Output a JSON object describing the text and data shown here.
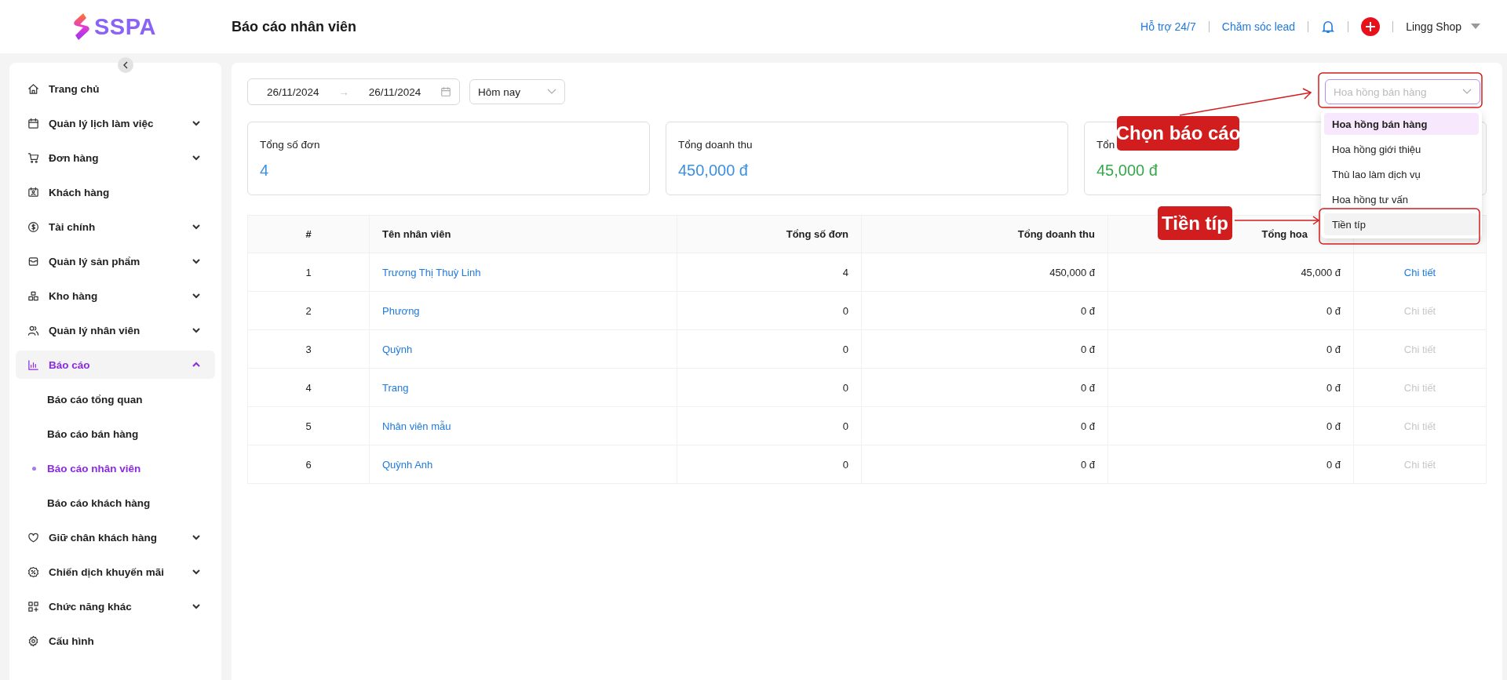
{
  "header": {
    "logo": "SSPA",
    "title": "Báo cáo nhân viên",
    "links": [
      "Hỗ trợ 24/7",
      "Chăm sóc lead"
    ],
    "shop": "Lingg Shop"
  },
  "sidebar": {
    "items": [
      {
        "label": "Trang chủ",
        "selected": false
      },
      {
        "label": "Quản lý lịch làm việc",
        "expanded": false,
        "selected": false
      },
      {
        "label": "Đơn hàng",
        "expanded": false,
        "selected": false
      },
      {
        "label": "Khách hàng",
        "selected": false
      },
      {
        "label": "Tài chính",
        "expanded": false,
        "selected": false
      },
      {
        "label": "Quản lý sản phẩm",
        "expanded": false,
        "selected": false
      },
      {
        "label": "Kho hàng",
        "expanded": false,
        "selected": false
      },
      {
        "label": "Quản lý nhân viên",
        "expanded": false,
        "selected": false
      },
      {
        "label": "Báo cáo",
        "expanded": true,
        "selected": true,
        "children": [
          {
            "label": "Báo cáo tổng quan",
            "selected": false
          },
          {
            "label": "Báo cáo bán hàng",
            "selected": false
          },
          {
            "label": "Báo cáo nhân viên",
            "selected": true
          },
          {
            "label": "Báo cáo khách hàng",
            "selected": false
          }
        ]
      },
      {
        "label": "Giữ chân khách hàng",
        "expanded": false,
        "selected": false
      },
      {
        "label": "Chiến dịch khuyến mãi",
        "expanded": false,
        "selected": false
      },
      {
        "label": "Chức năng khác",
        "expanded": false,
        "selected": false
      },
      {
        "label": "Cấu hình",
        "selected": false
      }
    ]
  },
  "filters": {
    "date_from": "26/11/2024",
    "range_separator": "→",
    "date_to": "26/11/2024",
    "period": "Hôm nay",
    "report_select": {
      "placeholder": "Hoa hồng bán hàng"
    }
  },
  "report_menu": [
    {
      "label": "Hoa hồng bán hàng",
      "selected": true,
      "highlighted": false
    },
    {
      "label": "Hoa hồng giới thiệu",
      "selected": false,
      "highlighted": false
    },
    {
      "label": "Thù lao làm dịch vụ",
      "selected": false,
      "highlighted": false
    },
    {
      "label": "Hoa hồng tư vấn",
      "selected": false,
      "highlighted": false
    },
    {
      "label": "Tiền típ",
      "selected": false,
      "highlighted": true
    }
  ],
  "summary_cards": [
    {
      "label": "Tổng số đơn",
      "value": "4",
      "color": "#3b8fe0"
    },
    {
      "label": "Tổng doanh thu",
      "value": "450,000 đ",
      "color": "#3b8fe0"
    },
    {
      "label": "Tổn",
      "value": "45,000 đ",
      "color": "#36a84a"
    }
  ],
  "table": {
    "columns": [
      "#",
      "Tên nhân viên",
      "Tổng số đơn",
      "Tổng doanh thu",
      "Tổng hoa"
    ],
    "rows": [
      {
        "index": "1",
        "name": "Trương Thị Thuỳ Linh",
        "orders": "4",
        "revenue": "450,000 đ",
        "commission": "45,000 đ",
        "action": "Chi tiết",
        "disabled": false
      },
      {
        "index": "2",
        "name": "Phương",
        "orders": "0",
        "revenue": "0 đ",
        "commission": "0 đ",
        "action": "Chi tiết",
        "disabled": true
      },
      {
        "index": "3",
        "name": "Quỳnh",
        "orders": "0",
        "revenue": "0 đ",
        "commission": "0 đ",
        "action": "Chi tiết",
        "disabled": true
      },
      {
        "index": "4",
        "name": "Trang",
        "orders": "0",
        "revenue": "0 đ",
        "commission": "0 đ",
        "action": "Chi tiết",
        "disabled": true
      },
      {
        "index": "5",
        "name": "Nhân viên mẫu",
        "orders": "0",
        "revenue": "0 đ",
        "commission": "0 đ",
        "action": "Chi tiết",
        "disabled": true
      },
      {
        "index": "6",
        "name": "Quỳnh Anh",
        "orders": "0",
        "revenue": "0 đ",
        "commission": "0 đ",
        "action": "Chi tiết",
        "disabled": true
      }
    ]
  },
  "annotations": [
    {
      "text": "Chọn báo cáo"
    },
    {
      "text": "Tiền típ"
    }
  ]
}
